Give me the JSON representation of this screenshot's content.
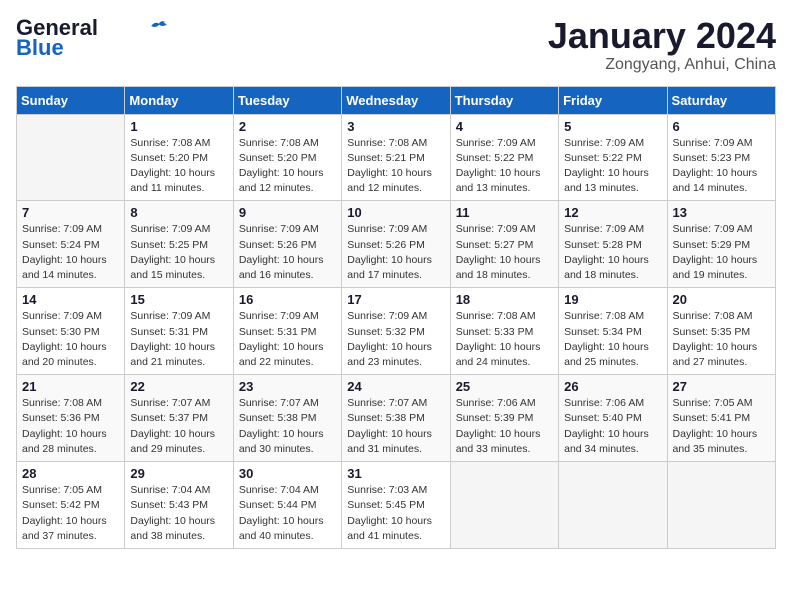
{
  "logo": {
    "line1": "General",
    "line2": "Blue"
  },
  "header": {
    "month_year": "January 2024",
    "location": "Zongyang, Anhui, China"
  },
  "weekdays": [
    "Sunday",
    "Monday",
    "Tuesday",
    "Wednesday",
    "Thursday",
    "Friday",
    "Saturday"
  ],
  "weeks": [
    [
      {
        "day": "",
        "info": ""
      },
      {
        "day": "1",
        "info": "Sunrise: 7:08 AM\nSunset: 5:20 PM\nDaylight: 10 hours\nand 11 minutes."
      },
      {
        "day": "2",
        "info": "Sunrise: 7:08 AM\nSunset: 5:20 PM\nDaylight: 10 hours\nand 12 minutes."
      },
      {
        "day": "3",
        "info": "Sunrise: 7:08 AM\nSunset: 5:21 PM\nDaylight: 10 hours\nand 12 minutes."
      },
      {
        "day": "4",
        "info": "Sunrise: 7:09 AM\nSunset: 5:22 PM\nDaylight: 10 hours\nand 13 minutes."
      },
      {
        "day": "5",
        "info": "Sunrise: 7:09 AM\nSunset: 5:22 PM\nDaylight: 10 hours\nand 13 minutes."
      },
      {
        "day": "6",
        "info": "Sunrise: 7:09 AM\nSunset: 5:23 PM\nDaylight: 10 hours\nand 14 minutes."
      }
    ],
    [
      {
        "day": "7",
        "info": "Sunrise: 7:09 AM\nSunset: 5:24 PM\nDaylight: 10 hours\nand 14 minutes."
      },
      {
        "day": "8",
        "info": "Sunrise: 7:09 AM\nSunset: 5:25 PM\nDaylight: 10 hours\nand 15 minutes."
      },
      {
        "day": "9",
        "info": "Sunrise: 7:09 AM\nSunset: 5:26 PM\nDaylight: 10 hours\nand 16 minutes."
      },
      {
        "day": "10",
        "info": "Sunrise: 7:09 AM\nSunset: 5:26 PM\nDaylight: 10 hours\nand 17 minutes."
      },
      {
        "day": "11",
        "info": "Sunrise: 7:09 AM\nSunset: 5:27 PM\nDaylight: 10 hours\nand 18 minutes."
      },
      {
        "day": "12",
        "info": "Sunrise: 7:09 AM\nSunset: 5:28 PM\nDaylight: 10 hours\nand 18 minutes."
      },
      {
        "day": "13",
        "info": "Sunrise: 7:09 AM\nSunset: 5:29 PM\nDaylight: 10 hours\nand 19 minutes."
      }
    ],
    [
      {
        "day": "14",
        "info": "Sunrise: 7:09 AM\nSunset: 5:30 PM\nDaylight: 10 hours\nand 20 minutes."
      },
      {
        "day": "15",
        "info": "Sunrise: 7:09 AM\nSunset: 5:31 PM\nDaylight: 10 hours\nand 21 minutes."
      },
      {
        "day": "16",
        "info": "Sunrise: 7:09 AM\nSunset: 5:31 PM\nDaylight: 10 hours\nand 22 minutes."
      },
      {
        "day": "17",
        "info": "Sunrise: 7:09 AM\nSunset: 5:32 PM\nDaylight: 10 hours\nand 23 minutes."
      },
      {
        "day": "18",
        "info": "Sunrise: 7:08 AM\nSunset: 5:33 PM\nDaylight: 10 hours\nand 24 minutes."
      },
      {
        "day": "19",
        "info": "Sunrise: 7:08 AM\nSunset: 5:34 PM\nDaylight: 10 hours\nand 25 minutes."
      },
      {
        "day": "20",
        "info": "Sunrise: 7:08 AM\nSunset: 5:35 PM\nDaylight: 10 hours\nand 27 minutes."
      }
    ],
    [
      {
        "day": "21",
        "info": "Sunrise: 7:08 AM\nSunset: 5:36 PM\nDaylight: 10 hours\nand 28 minutes."
      },
      {
        "day": "22",
        "info": "Sunrise: 7:07 AM\nSunset: 5:37 PM\nDaylight: 10 hours\nand 29 minutes."
      },
      {
        "day": "23",
        "info": "Sunrise: 7:07 AM\nSunset: 5:38 PM\nDaylight: 10 hours\nand 30 minutes."
      },
      {
        "day": "24",
        "info": "Sunrise: 7:07 AM\nSunset: 5:38 PM\nDaylight: 10 hours\nand 31 minutes."
      },
      {
        "day": "25",
        "info": "Sunrise: 7:06 AM\nSunset: 5:39 PM\nDaylight: 10 hours\nand 33 minutes."
      },
      {
        "day": "26",
        "info": "Sunrise: 7:06 AM\nSunset: 5:40 PM\nDaylight: 10 hours\nand 34 minutes."
      },
      {
        "day": "27",
        "info": "Sunrise: 7:05 AM\nSunset: 5:41 PM\nDaylight: 10 hours\nand 35 minutes."
      }
    ],
    [
      {
        "day": "28",
        "info": "Sunrise: 7:05 AM\nSunset: 5:42 PM\nDaylight: 10 hours\nand 37 minutes."
      },
      {
        "day": "29",
        "info": "Sunrise: 7:04 AM\nSunset: 5:43 PM\nDaylight: 10 hours\nand 38 minutes."
      },
      {
        "day": "30",
        "info": "Sunrise: 7:04 AM\nSunset: 5:44 PM\nDaylight: 10 hours\nand 40 minutes."
      },
      {
        "day": "31",
        "info": "Sunrise: 7:03 AM\nSunset: 5:45 PM\nDaylight: 10 hours\nand 41 minutes."
      },
      {
        "day": "",
        "info": ""
      },
      {
        "day": "",
        "info": ""
      },
      {
        "day": "",
        "info": ""
      }
    ]
  ]
}
